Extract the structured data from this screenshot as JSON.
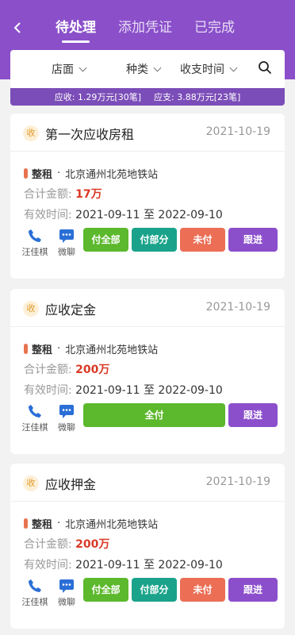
{
  "header": {
    "back_icon": "back-arrow-icon",
    "tabs": [
      "待处理",
      "添加凭证",
      "已完成"
    ]
  },
  "filter": {
    "items": [
      "店面",
      "种类",
      "收支时间"
    ],
    "search_icon": "search-icon"
  },
  "summary": {
    "receivable": "应收: 1.29万元[30笔]",
    "payable": "应支: 3.88万元[23笔]"
  },
  "cards": [
    {
      "badge": "收",
      "title": "第一次应收房租",
      "date": "2021-10-19",
      "type": "整租",
      "dot": "·",
      "location": "北京通州北苑地铁站",
      "total_label": "合计金额:",
      "total_value": "17万",
      "valid_label": "有效时间:",
      "valid_value": "2021-09-11 至 2022-09-10",
      "contact": "汪佳棋",
      "chat": "微聊",
      "buttons": [
        "付全部",
        "付部分",
        "未付",
        "跟进"
      ]
    },
    {
      "badge": "收",
      "title": "应收定金",
      "date": "2021-10-19",
      "type": "整租",
      "dot": "·",
      "location": "北京通州北苑地铁站",
      "total_label": "合计金额:",
      "total_value": "200万",
      "valid_label": "有效时间:",
      "valid_value": "2021-09-11 至 2022-09-10",
      "contact": "汪佳棋",
      "chat": "微聊",
      "buttons": [
        "全付",
        "跟进"
      ]
    },
    {
      "badge": "收",
      "title": "应收押金",
      "date": "2021-10-19",
      "type": "整租",
      "dot": "·",
      "location": "北京通州北苑地铁站",
      "total_label": "合计金额:",
      "total_value": "200万",
      "valid_label": "有效时间:",
      "valid_value": "2021-09-11 至 2022-09-10",
      "contact": "汪佳棋",
      "chat": "微聊",
      "buttons": [
        "付全部",
        "付部分",
        "未付",
        "跟进"
      ]
    }
  ],
  "colors": {
    "brand": "#8a4fc9",
    "green": "#5cb82c",
    "teal": "#1aa38a",
    "orange": "#eb6e55",
    "purple": "#8b4fcb",
    "amount": "#d93a25"
  }
}
